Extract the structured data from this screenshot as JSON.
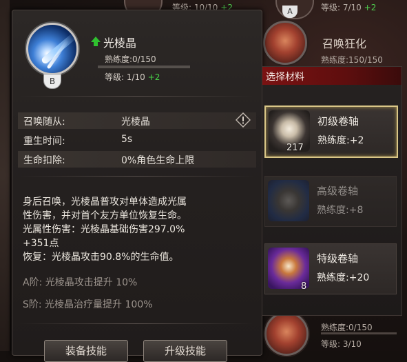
{
  "background": {
    "top_text_left": "等级: 10/10",
    "top_text_left_plus": "+2",
    "top_text_right": "等级: 7/10",
    "top_text_right_plus": "+2",
    "badge_a": "A",
    "skill_title": "召唤狂化",
    "skill_prof": "熟练度:150/150",
    "bottom_prof": "熟练度:0/150",
    "bottom_level": "等级: 3/10"
  },
  "skill": {
    "name": "光棱晶",
    "grade": "B",
    "proficiency_label": "熟练度:0/150",
    "proficiency_fraction": 0.0,
    "level_label": "等级: 1/10",
    "level_plus": "+2",
    "icon": "light-prism-icon"
  },
  "attributes": [
    {
      "label": "召唤随从:",
      "value": "光棱晶"
    },
    {
      "label": "重生时间:",
      "value": "5s"
    },
    {
      "label": "生命扣除:",
      "value": "0%角色生命上限"
    }
  ],
  "description": {
    "line1": "身后召唤，光棱晶普攻对单体造成光属",
    "line2": "性伤害，并对首个友方单位恢复生命。",
    "line3": "光属性伤害：光棱晶基础伤害297.0%",
    "line4": "+351点",
    "line5": "恢复：光棱晶攻击90.8%的生命值。",
    "tier_a": "A阶: 光棱晶攻击提升 10%",
    "tier_s": "S阶: 光棱晶治疗量提升 100%"
  },
  "buttons": {
    "equip": "装备技能",
    "upgrade": "升级技能"
  },
  "materials": {
    "header": "选择材料",
    "items": [
      {
        "name": "初级卷轴",
        "exp": "熟练度:+2",
        "count": "217",
        "selected": true,
        "enabled": true
      },
      {
        "name": "高级卷轴",
        "exp": "熟练度:+8",
        "count": "",
        "selected": false,
        "enabled": false
      },
      {
        "name": "特级卷轴",
        "exp": "熟练度:+20",
        "count": "8",
        "selected": false,
        "enabled": true
      }
    ]
  },
  "colors": {
    "accent_green": "#48d448",
    "header_red": "#7a1212",
    "selected_border": "#d9c687"
  }
}
